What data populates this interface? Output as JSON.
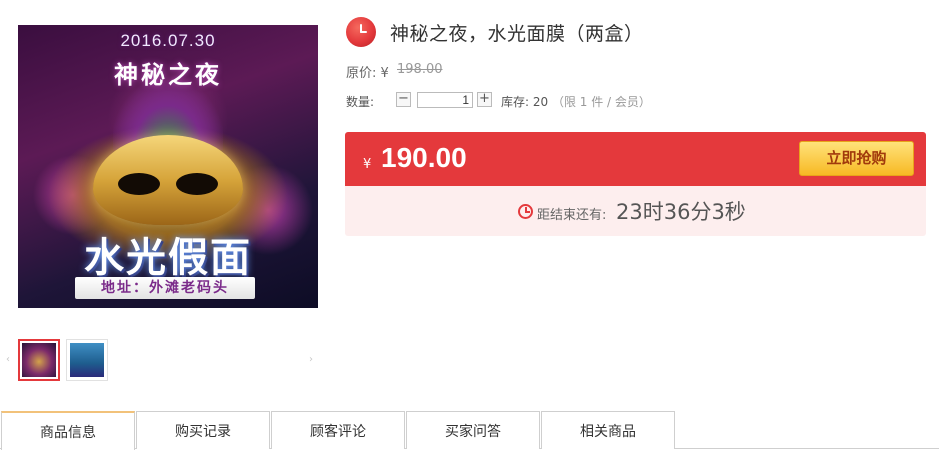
{
  "product": {
    "title": "神秘之夜，水光面膜（两盒）",
    "original_price_label": "原价: ¥",
    "original_price": "198.00",
    "currency_symbol": "¥",
    "sale_price": "190.00",
    "buy_button_label": "立即抢购"
  },
  "image": {
    "date_text": "2016.07.30",
    "title_text": "神秘之夜",
    "headline_text": "水光假面",
    "address_text": "地址：外滩老码头"
  },
  "thumbnails": {
    "prev_icon": "‹",
    "next_icon": "›",
    "items": [
      "thumb-mask-poster",
      "thumb-blue-poster"
    ]
  },
  "quantity": {
    "label": "数量:",
    "minus": "−",
    "plus": "+",
    "value": "1",
    "stock_text": "库存: 20",
    "limit_text": "（限 1 件 / 会员）"
  },
  "countdown": {
    "label": "距结束还有:",
    "time": "23时36分3秒"
  },
  "tabs": [
    {
      "label": "商品信息",
      "active": true
    },
    {
      "label": "购买记录",
      "active": false
    },
    {
      "label": "顾客评论",
      "active": false
    },
    {
      "label": "买家问答",
      "active": false
    },
    {
      "label": "相关商品",
      "active": false
    }
  ],
  "colors": {
    "accent_red": "#e4393c",
    "countdown_bg": "#fdeeee",
    "buy_button": "#f7b924"
  },
  "icons": {
    "title_badge": "clock-icon",
    "countdown": "clock-icon"
  }
}
